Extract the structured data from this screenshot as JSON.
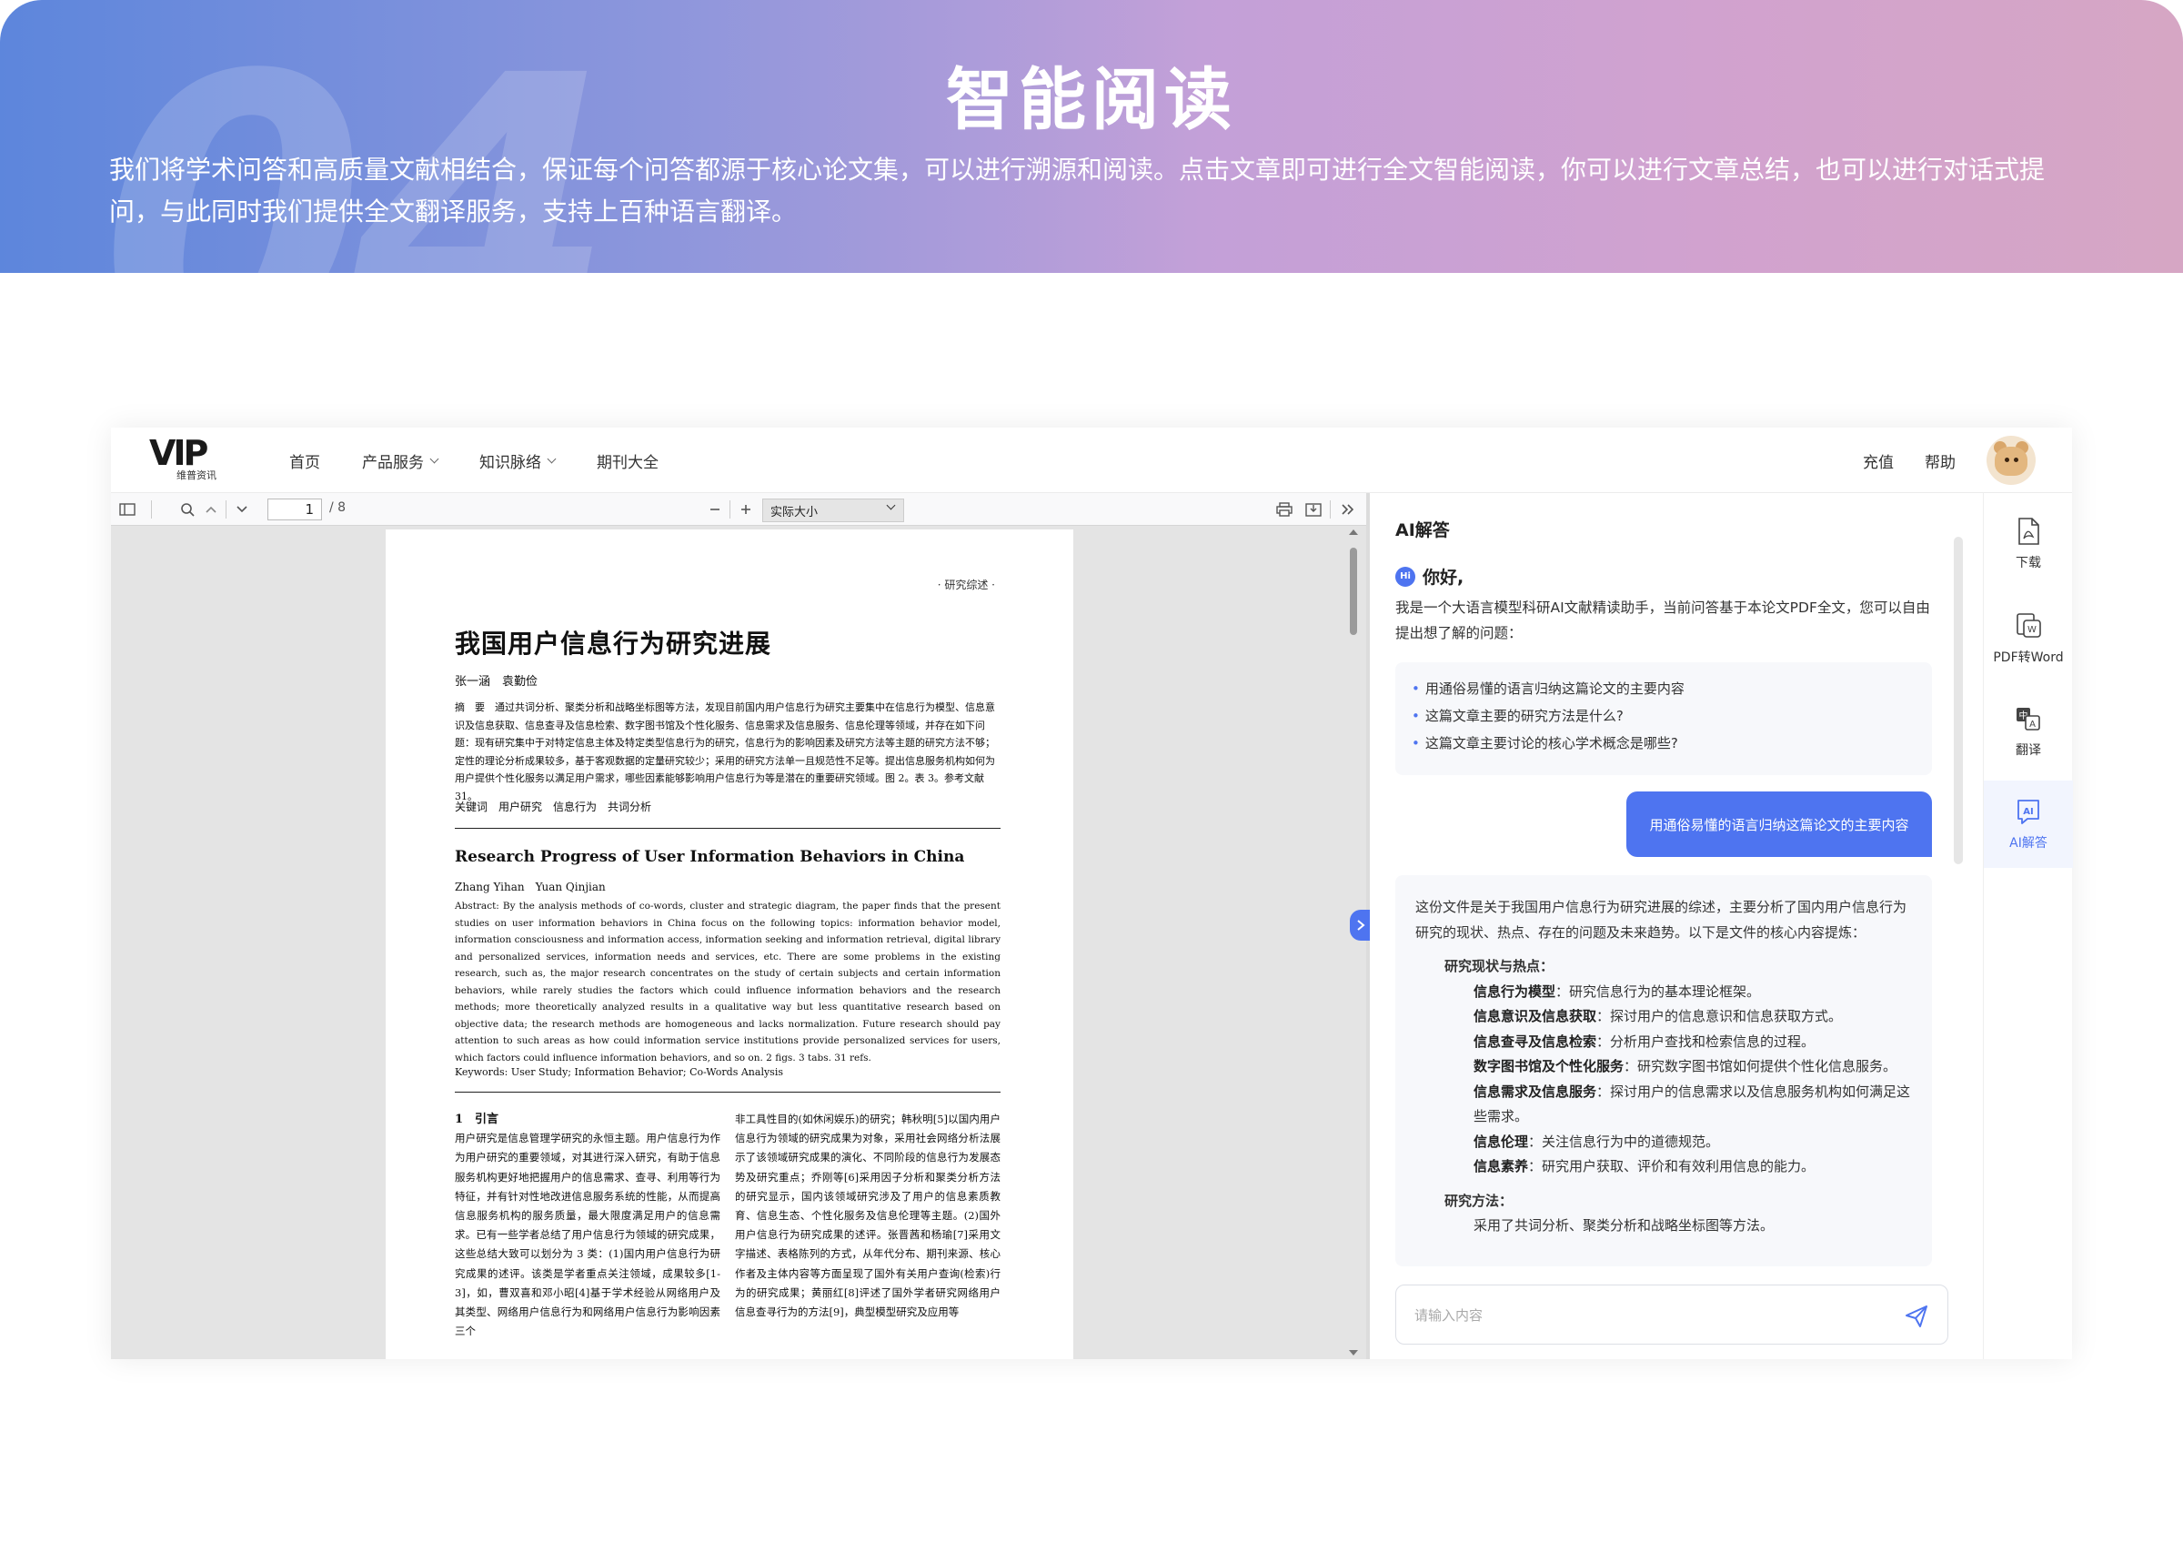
{
  "hero": {
    "number": "04",
    "title": "智能阅读",
    "description": "我们将学术问答和高质量文献相结合，保证每个问答都源于核心论文集，可以进行溯源和阅读。点击文章即可进行全文智能阅读，你可以进行文章总结，也可以进行对话式提问，与此同时我们提供全文翻译服务，支持上百种语言翻译。"
  },
  "nav": {
    "logo_mark": "VIP",
    "logo_sub": "维普资讯",
    "items": [
      "首页",
      "产品服务",
      "知识脉络",
      "期刊大全"
    ],
    "right_links": [
      "充值",
      "帮助"
    ]
  },
  "pdf": {
    "current_page": "1",
    "total_pages": "/ 8",
    "zoom": "实际大小",
    "page": {
      "tag": "· 研究综述 ·",
      "cn_title": "我国用户信息行为研究进展",
      "cn_authors": "张一涵　袁勤俭",
      "cn_abstract": "摘　要　通过共词分析、聚类分析和战略坐标图等方法，发现目前国内用户信息行为研究主要集中在信息行为模型、信息意识及信息获取、信息查寻及信息检索、数字图书馆及个性化服务、信息需求及信息服务、信息伦理等领域，并存在如下问题：现有研究集中于对特定信息主体及特定类型信息行为的研究，信息行为的影响因素及研究方法等主题的研究方法不够；定性的理论分析成果较多，基于客观数据的定量研究较少；采用的研究方法单一且规范性不足等。提出信息服务机构如何为用户提供个性化服务以满足用户需求，哪些因素能够影响用户信息行为等是潜在的重要研究领域。图 2。表 3。参考文献 31。",
      "cn_keywords": "关键词　用户研究　信息行为　共词分析",
      "en_title": "Research Progress of User Information Behaviors in China",
      "en_authors": "Zhang Yihan　Yuan Qinjian",
      "en_abstract": "Abstract: By the analysis methods of co-words, cluster and strategic diagram, the paper finds that the present studies on user information behaviors in China focus on the following topics: information behavior model, information consciousness and information access, information seeking and information retrieval, digital library and personalized services, information needs and services, etc. There are some problems in the existing research, such as, the major research concentrates on the study of certain subjects and certain information behaviors, while rarely studies the factors which could influence information behaviors and the research methods; more theoretically analyzed results in a qualitative way but less quantitative research based on objective data; the research methods are homogeneous and lacks normalization. Future research should pay attention to such areas as how could information service institutions provide personalized services for users, which factors could influence information behaviors, and so on. 2 figs. 3 tabs. 31 refs.",
      "en_keywords": "Keywords: User Study; Information Behavior; Co-Words Analysis",
      "section": "1　引言",
      "col_left": "用户研究是信息管理学研究的永恒主题。用户信息行为作为用户研究的重要领域，对其进行深入研究，有助于信息服务机构更好地把握用户的信息需求、查寻、利用等行为特征，并有针对性地改进信息服务系统的性能，从而提高信息服务机构的服务质量，最大限度满足用户的信息需求。已有一些学者总结了用户信息行为领域的研究成果，这些总结大致可以划分为 3 类：(1)国内用户信息行为研究成果的述评。该类是学者重点关注领域，成果较多[1-3]，如，曹双喜和邓小昭[4]基于学术经验从网络用户及其类型、网络用户信息行为和网络用户信息行为影响因素三个",
      "col_right": "非工具性目的(如休闲娱乐)的研究；韩秋明[5]以国内用户信息行为领域的研究成果为对象，采用社会网络分析法展示了该领域研究成果的演化、不同阶段的信息行为发展态势及研究重点；乔刚等[6]采用因子分析和聚类分析方法的研究显示，国内该领域研究涉及了用户的信息素质教育、信息生态、个性化服务及信息伦理等主题。(2)国外用户信息行为研究成果的述评。张晋茜和杨瑜[7]采用文字描述、表格陈列的方式，从年代分布、期刊来源、核心作者及主体内容等方面呈现了国外有关用户查询(检索)行为的研究成果；黄丽红[8]评述了国外学者研究网络用户信息查寻行为的方法[9]，典型模型研究及应用等"
    }
  },
  "ai": {
    "title": "AI解答",
    "hi_badge": "Hi",
    "greeting": "你好,",
    "intro": "我是一个大语言模型科研AI文献精读助手，当前问答基于本论文PDF全文，您可以自由提出想了解的问题：",
    "suggestions": [
      "用通俗易懂的语言归纳这篇论文的主要内容",
      "这篇文章主要的研究方法是什么?",
      "这篇文章主要讨论的核心学术概念是哪些?"
    ],
    "user_message": "用通俗易懂的语言归纳这篇论文的主要内容",
    "answer": {
      "intro": "这份文件是关于我国用户信息行为研究进展的综述，主要分析了国内用户信息行为研究的现状、热点、存在的问题及未来趋势。以下是文件的核心内容提炼：",
      "section1": "研究现状与热点：",
      "points": [
        {
          "k": "信息行为模型",
          "v": "：研究信息行为的基本理论框架。"
        },
        {
          "k": "信息意识及信息获取",
          "v": "：探讨用户的信息意识和信息获取方式。"
        },
        {
          "k": "信息查寻及信息检索",
          "v": "：分析用户查找和检索信息的过程。"
        },
        {
          "k": "数字图书馆及个性化服务",
          "v": "：研究数字图书馆如何提供个性化信息服务。"
        },
        {
          "k": "信息需求及信息服务",
          "v": "：探讨用户的信息需求以及信息服务机构如何满足这些需求。"
        },
        {
          "k": "信息伦理",
          "v": "：关注信息行为中的道德规范。"
        },
        {
          "k": "信息素养",
          "v": "：研究用户获取、评价和有效利用信息的能力。"
        }
      ],
      "section2": "研究方法：",
      "method": "采用了共词分析、聚类分析和战略坐标图等方法。"
    },
    "input_placeholder": "请输入内容"
  },
  "tools": [
    {
      "label": "下载",
      "icon": "pdf-download-icon"
    },
    {
      "label": "PDF转Word",
      "icon": "pdf-to-word-icon"
    },
    {
      "label": "翻译",
      "icon": "translate-icon"
    },
    {
      "label": "AI解答",
      "icon": "ai-answer-icon"
    }
  ],
  "colors": {
    "accent": "#4e74f0",
    "hero_start": "#5d86dc",
    "hero_end": "#d6a6c4"
  }
}
